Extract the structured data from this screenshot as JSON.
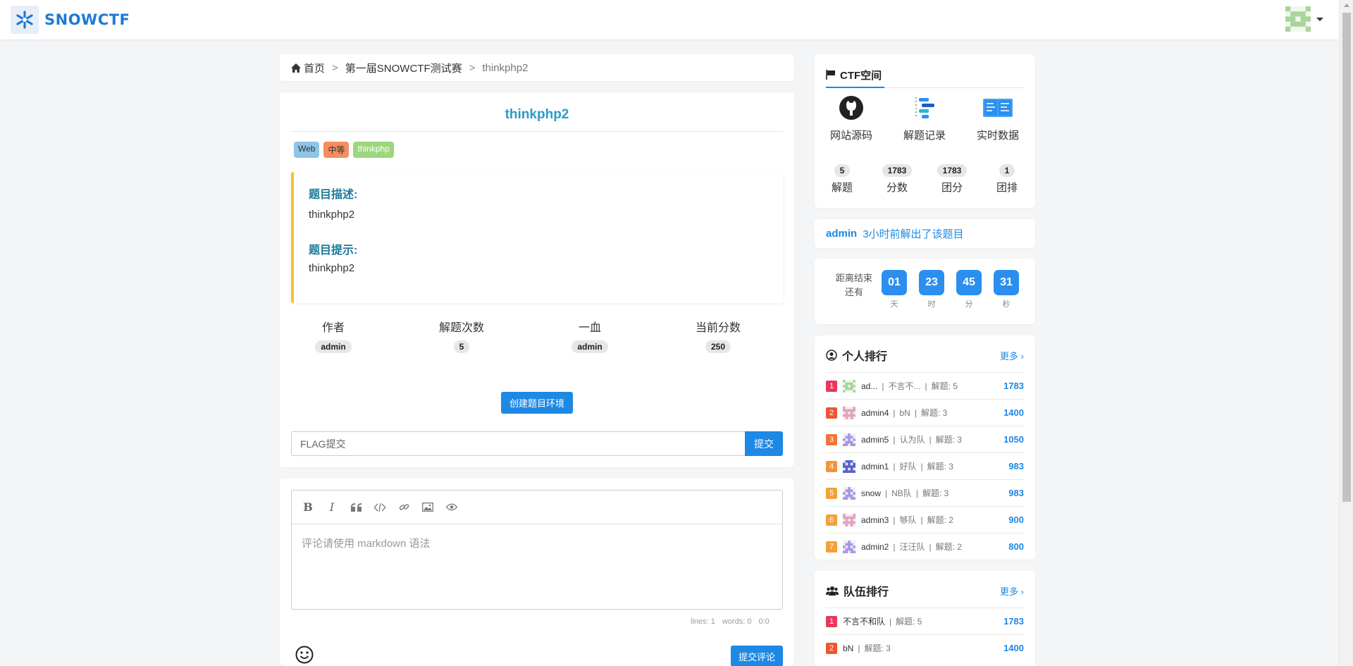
{
  "brand": {
    "name": "SNOWCTF"
  },
  "breadcrumb": {
    "home": "首页",
    "contest": "第一届SNOWCTF测试赛",
    "current": "thinkphp2"
  },
  "challenge": {
    "title": "thinkphp2",
    "tags": [
      "Web",
      "中等",
      "thinkphp"
    ],
    "desc_label": "题目描述:",
    "desc_text": "thinkphp2",
    "hint_label": "题目提示:",
    "hint_text": "thinkphp2",
    "stats": [
      {
        "label": "作者",
        "value": "admin"
      },
      {
        "label": "解题次数",
        "value": "5"
      },
      {
        "label": "一血",
        "value": "admin"
      },
      {
        "label": "当前分数",
        "value": "250"
      }
    ],
    "create_env_label": "创建题目环境",
    "flag_placeholder": "FLAG提交",
    "submit_label": "提交"
  },
  "comment": {
    "placeholder": "评论请使用 markdown 语法",
    "lines": "lines: 1",
    "words": "words: 0",
    "cursor": "0:0",
    "submit_label": "提交评论"
  },
  "ctf_space": {
    "title": "CTF空间",
    "links": [
      {
        "label": "网站源码",
        "icon": "github-icon"
      },
      {
        "label": "解题记录",
        "icon": "timeline-icon"
      },
      {
        "label": "实时数据",
        "icon": "screen-icon"
      }
    ],
    "stats": [
      {
        "value": "5",
        "label": "解题"
      },
      {
        "value": "1783",
        "label": "分数"
      },
      {
        "value": "1783",
        "label": "团分"
      },
      {
        "value": "1",
        "label": "团排"
      }
    ]
  },
  "solved_note": {
    "who": "admin",
    "text": "3小时前解出了该题目"
  },
  "countdown": {
    "label_line1": "距离结束",
    "label_line2": "还有",
    "units": [
      {
        "value": "01",
        "unit": "天"
      },
      {
        "value": "23",
        "unit": "时"
      },
      {
        "value": "45",
        "unit": "分"
      },
      {
        "value": "31",
        "unit": "秒"
      }
    ]
  },
  "personal_rank": {
    "title": "个人排行",
    "more": "更多 ›",
    "rows": [
      {
        "rank": "1",
        "name": "ad...",
        "team": "不言不...",
        "solved": "解题: 5",
        "score": "1783"
      },
      {
        "rank": "2",
        "name": "admin4",
        "team": "bN",
        "solved": "解题: 3",
        "score": "1400"
      },
      {
        "rank": "3",
        "name": "admin5",
        "team": "认为队",
        "solved": "解题: 3",
        "score": "1050"
      },
      {
        "rank": "4",
        "name": "admin1",
        "team": "好队",
        "solved": "解题: 3",
        "score": "983"
      },
      {
        "rank": "5",
        "name": "snow",
        "team": "NB队",
        "solved": "解题: 3",
        "score": "983"
      },
      {
        "rank": "6",
        "name": "admin3",
        "team": "够队",
        "solved": "解题: 2",
        "score": "900"
      },
      {
        "rank": "7",
        "name": "admin2",
        "team": "汪汪队",
        "solved": "解题: 2",
        "score": "800"
      }
    ]
  },
  "team_rank": {
    "title": "队伍排行",
    "more": "更多 ›",
    "rows": [
      {
        "rank": "1",
        "team": "不言不和队",
        "solved": "解题: 5",
        "score": "1783"
      },
      {
        "rank": "2",
        "team": "bN",
        "solved": "解题: 3",
        "score": "1400"
      }
    ]
  },
  "colors": {
    "accent": "#1e88e5",
    "title": "#2b9ac8",
    "desc_border": "#f9c12a"
  }
}
